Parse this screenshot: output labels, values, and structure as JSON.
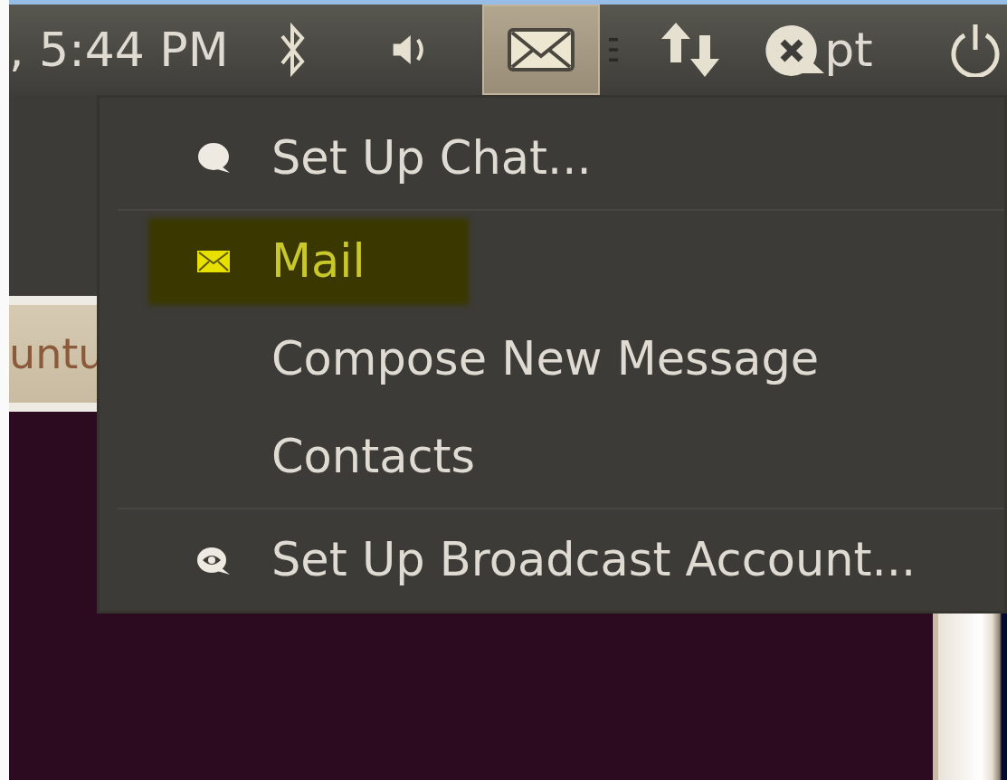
{
  "panel": {
    "clock": ", 5:44 PM",
    "indicators": [
      {
        "kind": "bluetooth",
        "selected": false
      },
      {
        "kind": "sound",
        "selected": false
      },
      {
        "kind": "mail",
        "selected": true
      },
      {
        "kind": "network",
        "selected": false
      },
      {
        "kind": "chat",
        "selected": false
      },
      {
        "kind": "label",
        "text": "pt",
        "selected": false
      },
      {
        "kind": "power",
        "selected": false
      }
    ]
  },
  "menu": {
    "items": [
      {
        "kind": "chat",
        "label": "Set Up Chat...",
        "selected": false
      },
      {
        "kind": "separator"
      },
      {
        "kind": "mail",
        "label": "Mail",
        "selected": true
      },
      {
        "kind": "plain",
        "label": "Compose New Message",
        "selected": false
      },
      {
        "kind": "plain",
        "label": "Contacts",
        "selected": false
      },
      {
        "kind": "separator"
      },
      {
        "kind": "broadcast",
        "label": "Set Up Broadcast Account...",
        "selected": false
      }
    ]
  },
  "background_window": {
    "tab_label": "untu"
  }
}
